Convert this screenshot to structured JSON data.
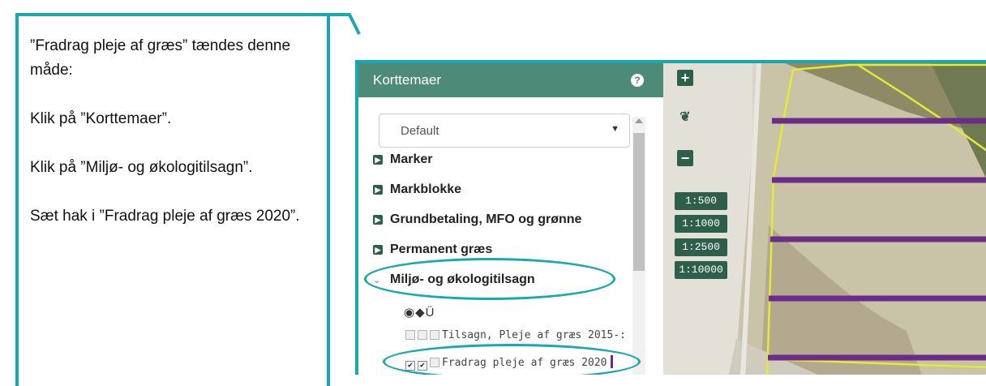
{
  "instructions": {
    "p1": "”Fradrag pleje af græs” tændes denne måde:",
    "p2": "Klik på ”Korttemaer”.",
    "p3": "Klik på ”Miljø- og økologitilsagn”.",
    "p4": "Sæt hak i ”Fradrag pleje af græs 2020”."
  },
  "panel": {
    "title": "Korttemaer",
    "select_value": "Default",
    "layers": [
      {
        "label": "Marker"
      },
      {
        "label": "Markblokke"
      },
      {
        "label": "Grundbetaling, MFO og grønne"
      },
      {
        "label": "Permanent græs"
      },
      {
        "label": "Miljø- og økologitilsagn",
        "expanded": true
      }
    ],
    "sublayers": [
      {
        "label": "Tilsagn, Pleje af græs 2015-:",
        "visible": false,
        "labels": false
      },
      {
        "label": "Fradrag pleje af græs 2020",
        "visible": true,
        "labels": true
      }
    ]
  },
  "map": {
    "scales": [
      "1:500",
      "1:1000",
      "1:2500",
      "1:10000"
    ],
    "accent": "#18a8b0",
    "stripe_color": "#6b2c8a",
    "boundary_color": "#e4ea35"
  }
}
